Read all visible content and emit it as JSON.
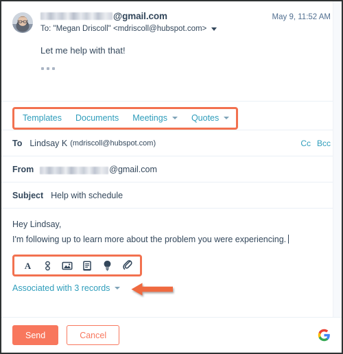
{
  "thread": {
    "avatar_icon": "user-photo-avatar",
    "sender_redacted": true,
    "sender_domain": "@gmail.com",
    "timestamp": "May 9, 11:52 AM",
    "recipient_line": "To: \"Megan Driscoll\" <mdriscoll@hubspot.com>",
    "recipient_caret_icon": "chevron-down-icon",
    "snippet": "Let me help with that!",
    "expand_icon": "ellipsis-icon"
  },
  "tabs": {
    "highlighted": true,
    "highlight_color": "#f2714f",
    "link_color": "#2e9dbb",
    "items": [
      {
        "label": "Templates",
        "has_caret": false
      },
      {
        "label": "Documents",
        "has_caret": false
      },
      {
        "label": "Meetings",
        "has_caret": true
      },
      {
        "label": "Quotes",
        "has_caret": true
      }
    ]
  },
  "compose": {
    "to_label": "To",
    "to_value": "Lindsay K",
    "to_email": "(mdriscoll@hubspot.com)",
    "cc_label": "Cc",
    "bcc_label": "Bcc",
    "from_label": "From",
    "from_redacted": true,
    "from_domain": "@gmail.com",
    "subject_label": "Subject",
    "subject_value": "Help with schedule",
    "body_line1": "Hey Lindsay,",
    "body_line2": "I'm following up to learn more about the problem you were experiencing."
  },
  "format_toolbar": {
    "highlighted": true,
    "highlight_color": "#f2714f",
    "icons": [
      {
        "name": "font-format-icon",
        "label": "A"
      },
      {
        "name": "link-icon",
        "label": "Insert link"
      },
      {
        "name": "image-icon",
        "label": "Insert image"
      },
      {
        "name": "document-icon",
        "label": "Insert document"
      },
      {
        "name": "lightbulb-icon",
        "label": "Knowledge article"
      },
      {
        "name": "paperclip-icon",
        "label": "Attach file"
      }
    ]
  },
  "associated": {
    "label": "Associated with 3 records",
    "caret_icon": "chevron-down-icon",
    "count": 3,
    "annotation_arrow": "left-arrow-annotation",
    "annotation_color": "#ef6a41"
  },
  "footer": {
    "send_label": "Send",
    "cancel_label": "Cancel",
    "send_color": "#f8775d",
    "provider_icon": "google-g-icon"
  }
}
